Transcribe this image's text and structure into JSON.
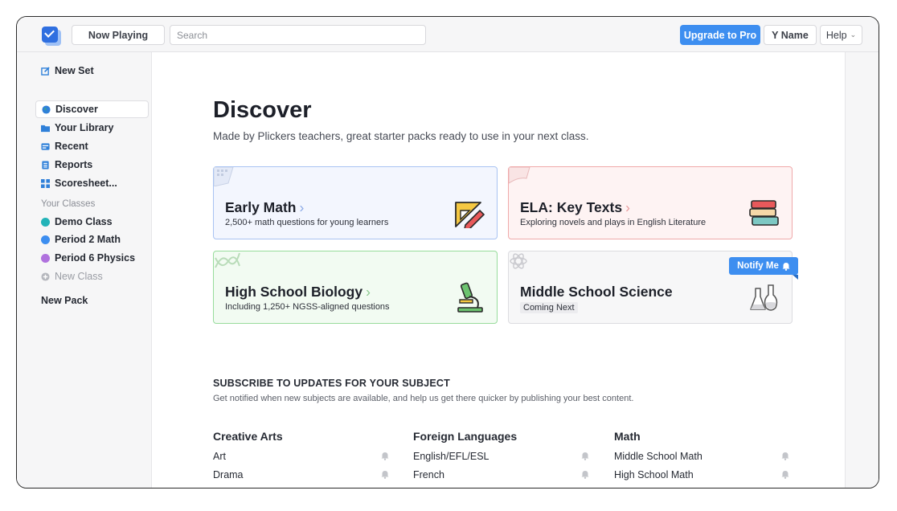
{
  "topbar": {
    "now_playing": "Now Playing",
    "search_placeholder": "Search",
    "upgrade": "Upgrade to Pro",
    "user": "Y Name",
    "help": "Help",
    "help_chevron": "⌄"
  },
  "sidebar": {
    "new_set": "New Set",
    "nav": [
      {
        "label": "Discover",
        "icon": "globe-icon",
        "color": "#2f80d9"
      },
      {
        "label": "Your Library",
        "icon": "folder-icon",
        "color": "#2f80d9"
      },
      {
        "label": "Recent",
        "icon": "clock-icon",
        "color": "#2f80d9"
      },
      {
        "label": "Reports",
        "icon": "report-icon",
        "color": "#2f80d9"
      },
      {
        "label": "Scoresheet...",
        "icon": "grid-icon",
        "color": "#2f80d9"
      }
    ],
    "classes_heading": "Your Classes",
    "classes": [
      {
        "label": "Demo Class",
        "color": "#22b3b8"
      },
      {
        "label": "Period 2 Math",
        "color": "#3d8ef0"
      },
      {
        "label": "Period 6 Physics",
        "color": "#b072de"
      }
    ],
    "new_class": "New Class",
    "new_pack": "New Pack"
  },
  "main": {
    "title": "Discover",
    "subtitle": "Made by Plickers teachers, great starter packs ready to use in your next class.",
    "cards": [
      {
        "title": "Early Math",
        "subtitle": "2,500+ math questions for young learners",
        "arrow": "›",
        "bg": "#f3f6fe",
        "border": "#a9c3f2",
        "arrow_color": "#8aa9e6",
        "icon": "ruler-pencil-icon"
      },
      {
        "title": "ELA: Key Texts",
        "subtitle": "Exploring novels and plays in English Literature",
        "arrow": "›",
        "bg": "#fef3f3",
        "border": "#f0a9aa",
        "arrow_color": "#e89a9c",
        "icon": "books-icon"
      },
      {
        "title": "High School Biology",
        "subtitle": "Including 1,250+ NGSS-aligned questions",
        "arrow": "›",
        "bg": "#f2fbf2",
        "border": "#98dc9c",
        "arrow_color": "#8ac98e",
        "icon": "microscope-icon"
      },
      {
        "title": "Middle School Science",
        "subtitle": "Coming Next",
        "notify": "Notify Me",
        "bg": "#f7f7f8",
        "border": "#dcdce0",
        "icon": "flasks-icon"
      }
    ],
    "subscribe_heading": "SUBSCRIBE TO UPDATES FOR YOUR SUBJECT",
    "subscribe_desc": "Get notified when new subjects are available, and help us get there quicker by publishing your best content.",
    "columns": [
      {
        "title": "Creative Arts",
        "items": [
          "Art",
          "Drama"
        ]
      },
      {
        "title": "Foreign Languages",
        "items": [
          "English/EFL/ESL",
          "French"
        ]
      },
      {
        "title": "Math",
        "items": [
          "Middle School Math",
          "High School Math"
        ]
      }
    ]
  }
}
